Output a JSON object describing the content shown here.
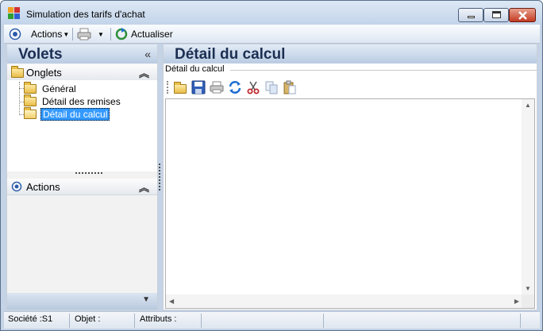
{
  "window": {
    "title": "Simulation des tarifs d'achat"
  },
  "toolbar": {
    "actions_label": "Actions",
    "refresh_label": "Actualiser"
  },
  "left_panel": {
    "title": "Volets",
    "tabs_group": {
      "title": "Onglets",
      "items": [
        {
          "label": "Général"
        },
        {
          "label": "Détail des remises"
        },
        {
          "label": "Détail du calcul"
        }
      ],
      "selected": "Détail du calcul"
    },
    "actions_group": {
      "title": "Actions"
    }
  },
  "right_panel": {
    "title": "Détail du calcul",
    "section_label": "Détail du calcul"
  },
  "statusbar": {
    "societe": "Société :S1",
    "objet": "Objet :",
    "attributs": "Attributs :"
  },
  "colors": {
    "accent": "#3399ff",
    "header_text": "#1c2f52"
  }
}
